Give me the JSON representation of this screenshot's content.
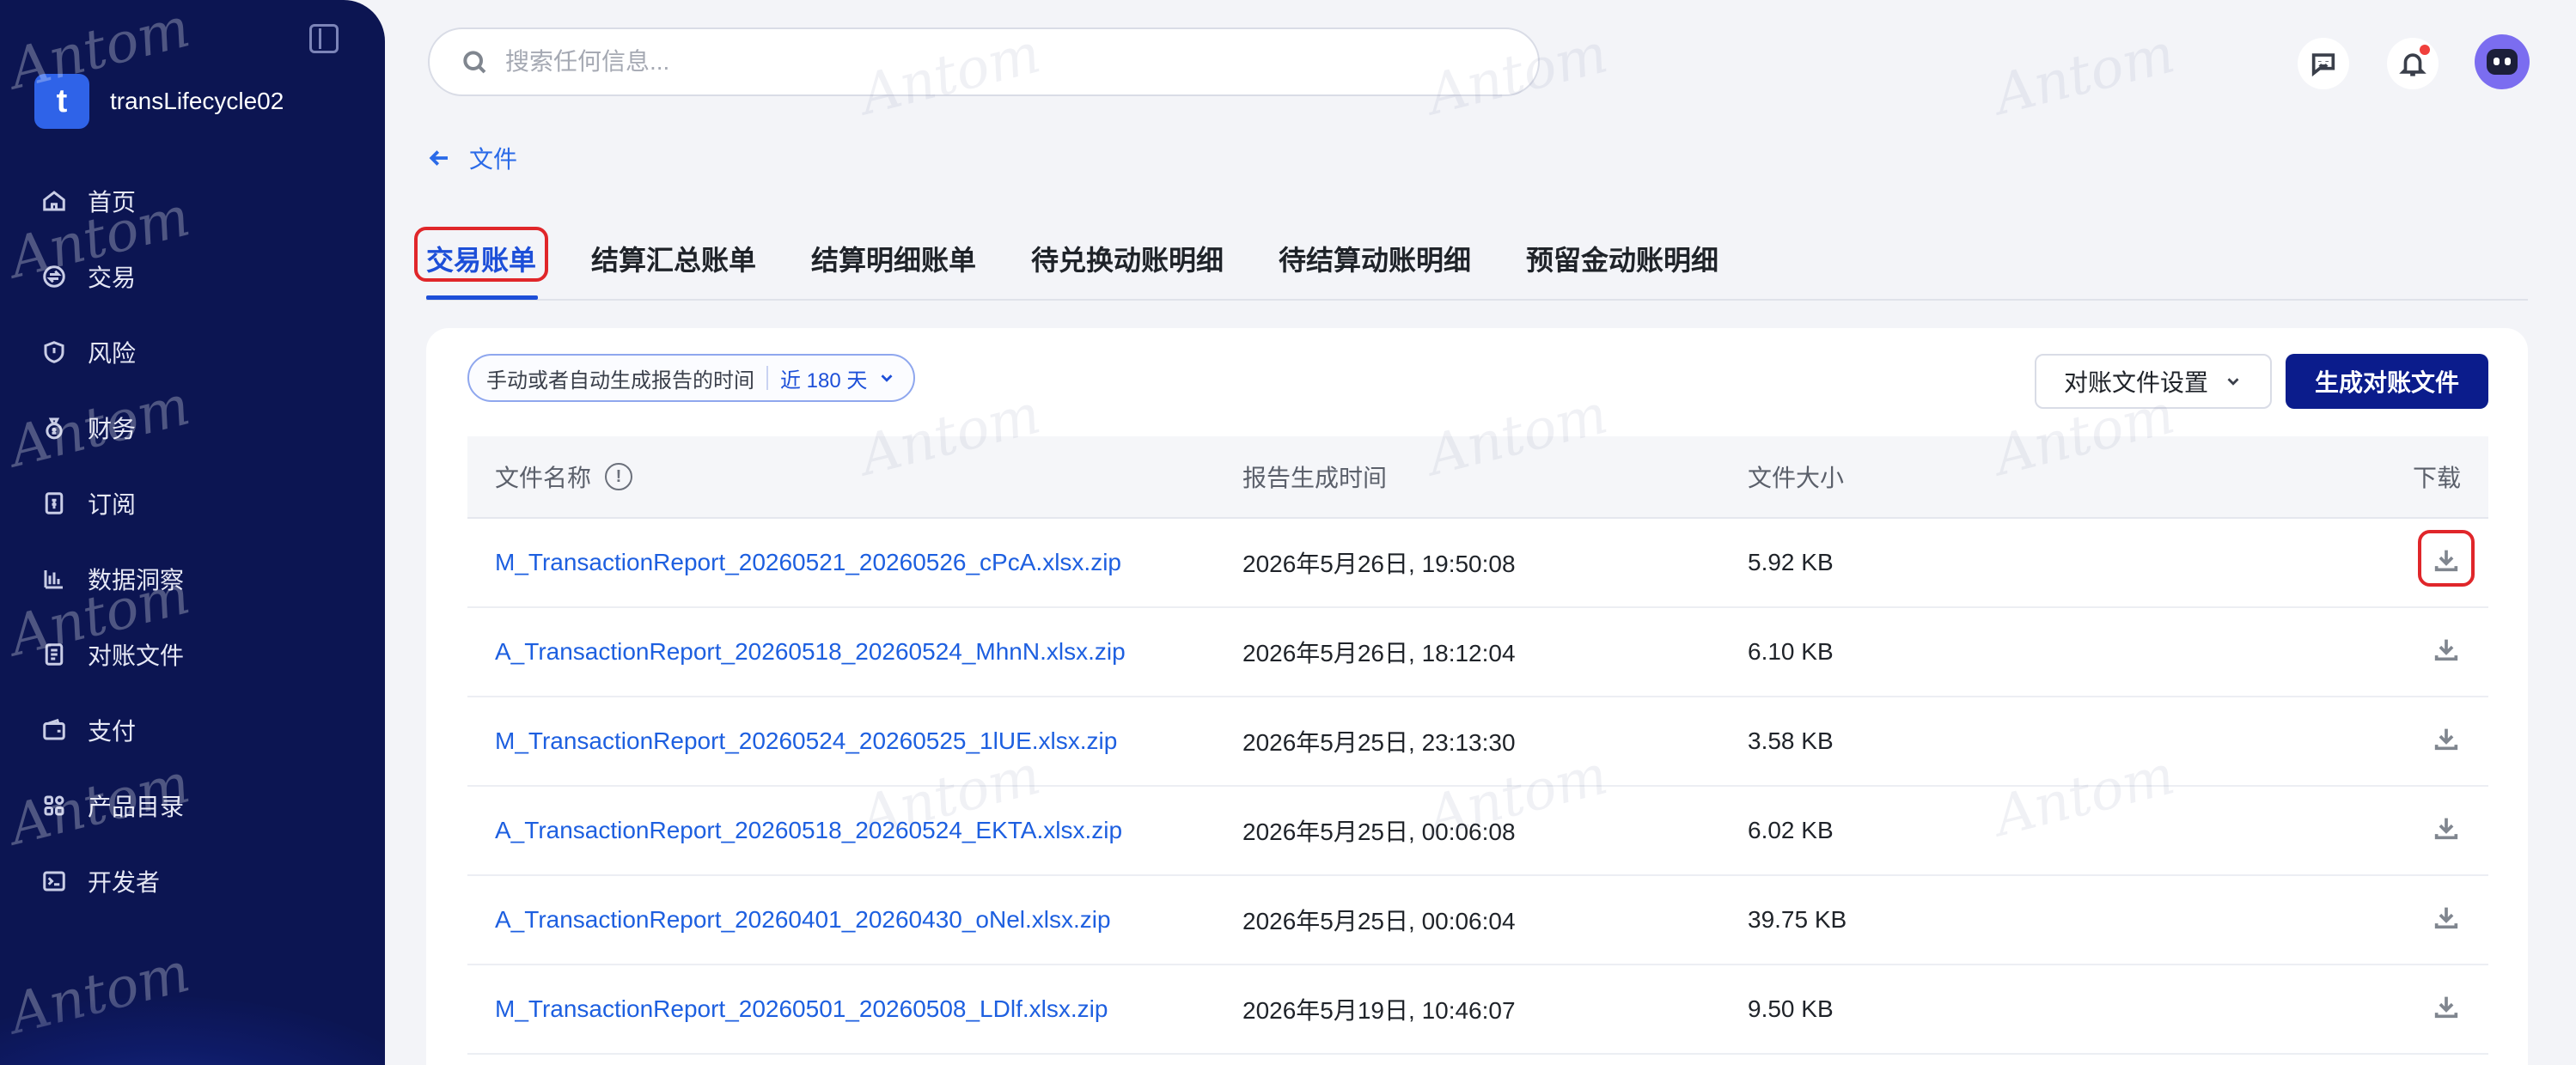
{
  "sidebar": {
    "brand_letter": "t",
    "brand_name": "transLifecycle02",
    "items": [
      {
        "label": "首页",
        "icon": "home-icon"
      },
      {
        "label": "交易",
        "icon": "exchange-icon"
      },
      {
        "label": "风险",
        "icon": "shield-icon"
      },
      {
        "label": "财务",
        "icon": "money-bag-icon"
      },
      {
        "label": "订阅",
        "icon": "subscription-icon"
      },
      {
        "label": "数据洞察",
        "icon": "bar-chart-icon"
      },
      {
        "label": "对账文件",
        "icon": "document-icon"
      },
      {
        "label": "支付",
        "icon": "wallet-icon"
      },
      {
        "label": "产品目录",
        "icon": "grid-icon"
      },
      {
        "label": "开发者",
        "icon": "terminal-icon"
      }
    ]
  },
  "search": {
    "placeholder": "搜索任何信息..."
  },
  "breadcrumb": {
    "back_label": "文件"
  },
  "tabs": [
    {
      "label": "交易账单",
      "active": true
    },
    {
      "label": "结算汇总账单",
      "active": false
    },
    {
      "label": "结算明细账单",
      "active": false
    },
    {
      "label": "待兑换动账明细",
      "active": false
    },
    {
      "label": "待结算动账明细",
      "active": false
    },
    {
      "label": "预留金动账明细",
      "active": false
    }
  ],
  "filter": {
    "label": "手动或者自动生成报告的时间",
    "value": "近 180 天"
  },
  "buttons": {
    "settings": "对账文件设置",
    "generate": "生成对账文件"
  },
  "table": {
    "headers": {
      "name": "文件名称",
      "time": "报告生成时间",
      "size": "文件大小",
      "download": "下载"
    },
    "rows": [
      {
        "name": "M_TransactionReport_20260521_20260526_cPcA.xlsx.zip",
        "time": "2026年5月26日, 19:50:08",
        "size": "5.92 KB"
      },
      {
        "name": "A_TransactionReport_20260518_20260524_MhnN.xlsx.zip",
        "time": "2026年5月26日, 18:12:04",
        "size": "6.10 KB"
      },
      {
        "name": "M_TransactionReport_20260524_20260525_1lUE.xlsx.zip",
        "time": "2026年5月25日, 23:13:30",
        "size": "3.58 KB"
      },
      {
        "name": "A_TransactionReport_20260518_20260524_EKTA.xlsx.zip",
        "time": "2026年5月25日, 00:06:08",
        "size": "6.02 KB"
      },
      {
        "name": "A_TransactionReport_20260401_20260430_oNel.xlsx.zip",
        "time": "2026年5月25日, 00:06:04",
        "size": "39.75 KB"
      },
      {
        "name": "M_TransactionReport_20260501_20260508_LDlf.xlsx.zip",
        "time": "2026年5月19日, 10:46:07",
        "size": "9.50 KB"
      }
    ]
  },
  "watermark": "Antom",
  "colors": {
    "sidebar_bg": "#0c1552",
    "accent": "#1d4fd8",
    "primary_button": "#0b1c8c",
    "highlight": "#e0262a"
  }
}
